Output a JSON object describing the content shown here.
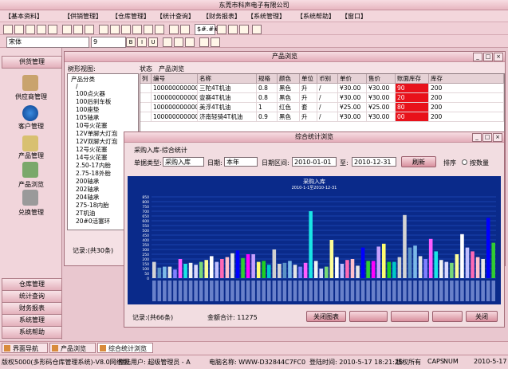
{
  "app": {
    "title": "东莞市科声电子有限公司"
  },
  "menu": [
    "【基本资料】",
    "【供销管理】",
    "【仓库管理】",
    "【统计查询】",
    "【财务报表】",
    "【系统管理】",
    "【系统帮助】",
    "【窗口】"
  ],
  "toolbar": {
    "font": "宋体",
    "size": "9",
    "currency_sample": "$#.##"
  },
  "sidebar": {
    "header": "供货管理",
    "items": [
      "供应商管理",
      "客户管理",
      "产品管理",
      "产品浏览",
      "兑换管理"
    ],
    "bottom": [
      "仓库管理",
      "统计查询",
      "财务报表",
      "系统管理",
      "系统帮助"
    ]
  },
  "product_window": {
    "title": "产品浏览",
    "tree_label": "树形视图:",
    "status_label": "状态",
    "status_value": "产品浏览",
    "tree": [
      "产品分类",
      "/",
      "100点火器",
      "100后刹车板",
      "100座垫",
      "105轴承",
      "10号火花塞",
      "12V单脚大灯泡",
      "12V双脚大灯泡",
      "12号火花塞",
      "14号火花塞",
      "2.50-17内胎",
      "2.75-18外胎",
      "200轴承",
      "202轴承",
      "204轴承",
      "275-18内胎",
      "2T机油",
      "20#0活塞环"
    ],
    "columns": [
      "列",
      "编号",
      "名称",
      "规格",
      "颜色",
      "单位",
      "币别",
      "单价",
      "售价",
      "账面库存",
      "库存"
    ],
    "rows": [
      {
        "code": "1000000000001",
        "name": "三陀4T机油",
        "spec": "0.8",
        "color": "黑色",
        "unit": "升",
        "cur": "/",
        "price": "¥30.00",
        "sale": "¥30.00",
        "book": "90",
        "stock": "200"
      },
      {
        "code": "1000000000002",
        "name": "壹赛4T机油",
        "spec": "0.8",
        "color": "黑色",
        "unit": "升",
        "cur": "/",
        "price": "¥30.00",
        "sale": "¥30.00",
        "book": "20",
        "stock": "200"
      },
      {
        "code": "1000000000003",
        "name": "美浮4T机油",
        "spec": "1",
        "color": "红色",
        "unit": "套",
        "cur": "/",
        "price": "¥25.00",
        "sale": "¥25.00",
        "book": "80",
        "stock": "200"
      },
      {
        "code": "1000000000004",
        "name": "济南轻骑4T机油",
        "spec": "0.9",
        "color": "黑色",
        "unit": "升",
        "cur": "/",
        "price": "¥30.00",
        "sale": "¥30.00",
        "book": "00",
        "stock": "200"
      }
    ],
    "record": "记录:(共30条)"
  },
  "stats_window": {
    "title": "综合统计浏览",
    "group": "采购入库-综合统计",
    "type_label": "单据类型:",
    "type_value": "采购入库",
    "date_label": "日期:",
    "date_value": "本年",
    "range_label": "日期区间:",
    "date_from": "2010-01-01",
    "to_label": "至:",
    "date_to": "2010-12-31",
    "refresh": "刷新",
    "sort_label": "排序",
    "sort_option": "按数量",
    "record": "记录:(共66条)",
    "total": "金额合计: 11275",
    "close_chart": "关闭图表",
    "close": "关闭"
  },
  "chart_data": {
    "type": "bar",
    "title": "采购入库",
    "subtitle": "2010-1-1至2010-12-31",
    "ylim": [
      0,
      900
    ],
    "yticks": [
      0,
      50,
      100,
      150,
      200,
      250,
      300,
      350,
      400,
      450,
      500,
      550,
      600,
      650,
      700,
      750,
      800,
      850
    ],
    "values": [
      170,
      110,
      120,
      120,
      90,
      200,
      150,
      160,
      140,
      170,
      190,
      230,
      170,
      200,
      220,
      260,
      290,
      210,
      250,
      250,
      170,
      180,
      140,
      300,
      150,
      160,
      180,
      140,
      120,
      160,
      700,
      180,
      100,
      120,
      400,
      220,
      150,
      190,
      200,
      130,
      320,
      180,
      180,
      330,
      360,
      170,
      170,
      220,
      660,
      320,
      340,
      230,
      200,
      410,
      280,
      190,
      170,
      160,
      250,
      460,
      320,
      280,
      220,
      200,
      630,
      370
    ],
    "colors": [
      "#d4d4d4",
      "#5a92c6",
      "#7cb9e8",
      "#e5e5e5",
      "#8080ff",
      "#ff5cff",
      "#19e6e6",
      "#f2f2f2",
      "#d8d8ff",
      "#78d878",
      "#fdfd96",
      "#ffffff",
      "#c0c0ff",
      "#ff69b4",
      "#ffc0cb",
      "#e6e6e6",
      "#0000ff",
      "#32cd32",
      "#ff00ff",
      "#c7a0ff",
      "#fefe70",
      "#1fd01f",
      "#00c8c8",
      "#d0d0d0"
    ]
  },
  "taskbar": [
    "界面导航",
    "产品浏览",
    "综合统计浏览"
  ],
  "status": [
    "版权5000(多形码仓库管理系统)-V8.0网络版",
    "登陆用户: 超级管理员 - A",
    "电脑名称: WWW-D32844C7FC0",
    "登陆时间: 2010-5-17 18:21:25",
    "版权所有",
    "CAPS",
    "NUM",
    "2010-5-17"
  ]
}
